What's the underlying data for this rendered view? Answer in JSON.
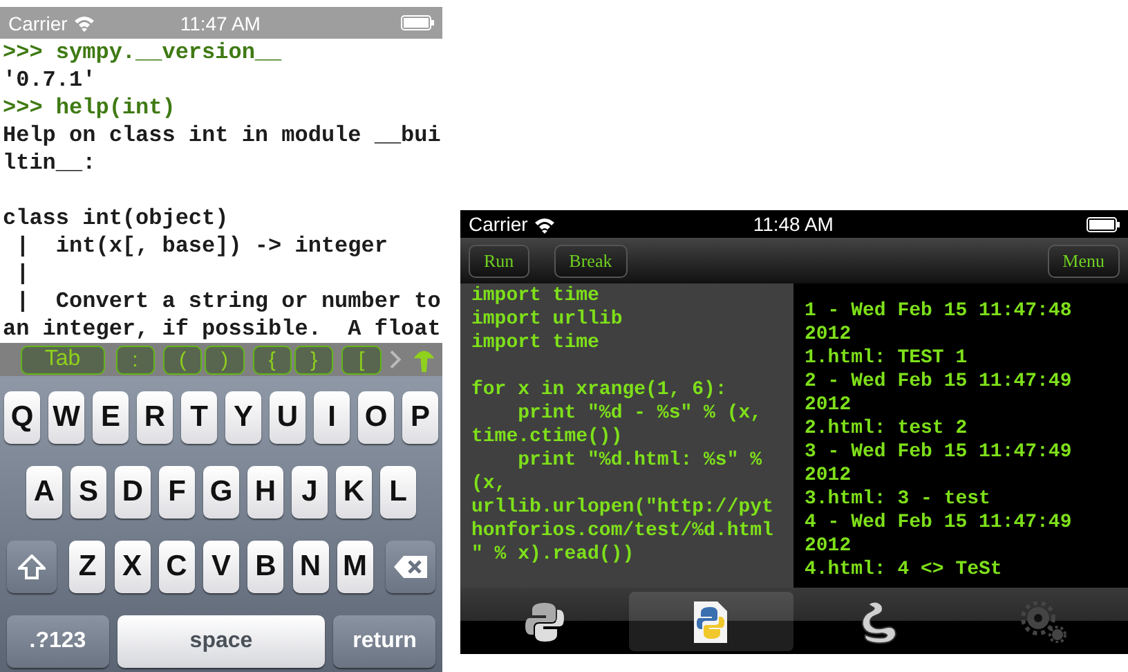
{
  "left_phone": {
    "status_bar": {
      "carrier": "Carrier",
      "time": "11:47 AM"
    },
    "console": [
      {
        "kind": "input",
        "text": ">>> sympy.__version__"
      },
      {
        "kind": "output",
        "text": "'0.7.1'"
      },
      {
        "kind": "input",
        "text": ">>> help(int)"
      },
      {
        "kind": "output",
        "text": "Help on class int in module __bui"
      },
      {
        "kind": "output",
        "text": "ltin__:"
      },
      {
        "kind": "blank"
      },
      {
        "kind": "output",
        "text": "class int(object)"
      },
      {
        "kind": "output",
        "text": " |  int(x[, base]) -> integer"
      },
      {
        "kind": "output",
        "text": " |"
      },
      {
        "kind": "output",
        "text": " |  Convert a string or number to"
      },
      {
        "kind": "output",
        "text": "an integer, if possible.  A float"
      }
    ],
    "accessory_keys": [
      {
        "label": "Tab",
        "kind": "wide"
      },
      {
        "label": ":",
        "kind": "symbol"
      },
      {
        "label": "(",
        "kind": "symbol"
      },
      {
        "label": ")",
        "kind": "symbol"
      },
      {
        "label": "{",
        "kind": "symbol"
      },
      {
        "label": "}",
        "kind": "symbol"
      },
      {
        "label": "[",
        "kind": "symbol"
      }
    ],
    "keyboard": [
      [
        {
          "label": "Q",
          "kind": "letter"
        },
        {
          "label": "W",
          "kind": "letter"
        },
        {
          "label": "E",
          "kind": "letter"
        },
        {
          "label": "R",
          "kind": "letter"
        },
        {
          "label": "T",
          "kind": "letter"
        },
        {
          "label": "Y",
          "kind": "letter"
        },
        {
          "label": "U",
          "kind": "letter"
        },
        {
          "label": "I",
          "kind": "letter"
        },
        {
          "label": "O",
          "kind": "letter"
        },
        {
          "label": "P",
          "kind": "letter"
        }
      ],
      [
        {
          "label": "A",
          "kind": "letter"
        },
        {
          "label": "S",
          "kind": "letter"
        },
        {
          "label": "D",
          "kind": "letter"
        },
        {
          "label": "F",
          "kind": "letter"
        },
        {
          "label": "G",
          "kind": "letter"
        },
        {
          "label": "H",
          "kind": "letter"
        },
        {
          "label": "J",
          "kind": "letter"
        },
        {
          "label": "K",
          "kind": "letter"
        },
        {
          "label": "L",
          "kind": "letter"
        }
      ],
      [
        {
          "kind": "shift"
        },
        {
          "label": "Z",
          "kind": "letter"
        },
        {
          "label": "X",
          "kind": "letter"
        },
        {
          "label": "C",
          "kind": "letter"
        },
        {
          "label": "V",
          "kind": "letter"
        },
        {
          "label": "B",
          "kind": "letter"
        },
        {
          "label": "N",
          "kind": "letter"
        },
        {
          "label": "M",
          "kind": "letter"
        },
        {
          "kind": "delete"
        }
      ],
      [
        {
          "label": ".?123",
          "kind": "mode"
        },
        {
          "label": "space",
          "kind": "space"
        },
        {
          "label": "return",
          "kind": "mode"
        }
      ]
    ]
  },
  "right_phone": {
    "status_bar": {
      "carrier": "Carrier",
      "time": "11:48 AM"
    },
    "toolbar": {
      "left": [
        "Run",
        "Break"
      ],
      "right": [
        "Menu"
      ]
    },
    "editor": [
      {
        "text": "import time"
      },
      {
        "text": "import urllib"
      },
      {
        "text": "import time"
      },
      {
        "kind": "blank"
      },
      {
        "text": "for x in xrange(1, 6):"
      },
      {
        "text": "    print \"%d - %s\" % (x,"
      },
      {
        "text": "time.ctime())"
      },
      {
        "text": "    print \"%d.html: %s\" %"
      },
      {
        "text": "(x,"
      },
      {
        "text": "urllib.urlopen(\"http://pyt"
      },
      {
        "text": "honforios.com/test/%d.html"
      },
      {
        "text": "\" % x).read())"
      }
    ],
    "output": [
      "1 - Wed Feb 15 11:47:48",
      "2012",
      "1.html: TEST 1",
      "2 - Wed Feb 15 11:47:49",
      "2012",
      "2.html: test 2",
      "3 - Wed Feb 15 11:47:49",
      "2012",
      "3.html: 3 - test",
      "4 - Wed Feb 15 11:47:49",
      "2012",
      "4.html: 4 <> TeSt"
    ],
    "tabs": [
      {
        "kind": "snake-logo",
        "selected": false
      },
      {
        "kind": "document",
        "selected": true
      },
      {
        "kind": "snake",
        "selected": false
      },
      {
        "kind": "gears",
        "selected": false
      }
    ]
  }
}
